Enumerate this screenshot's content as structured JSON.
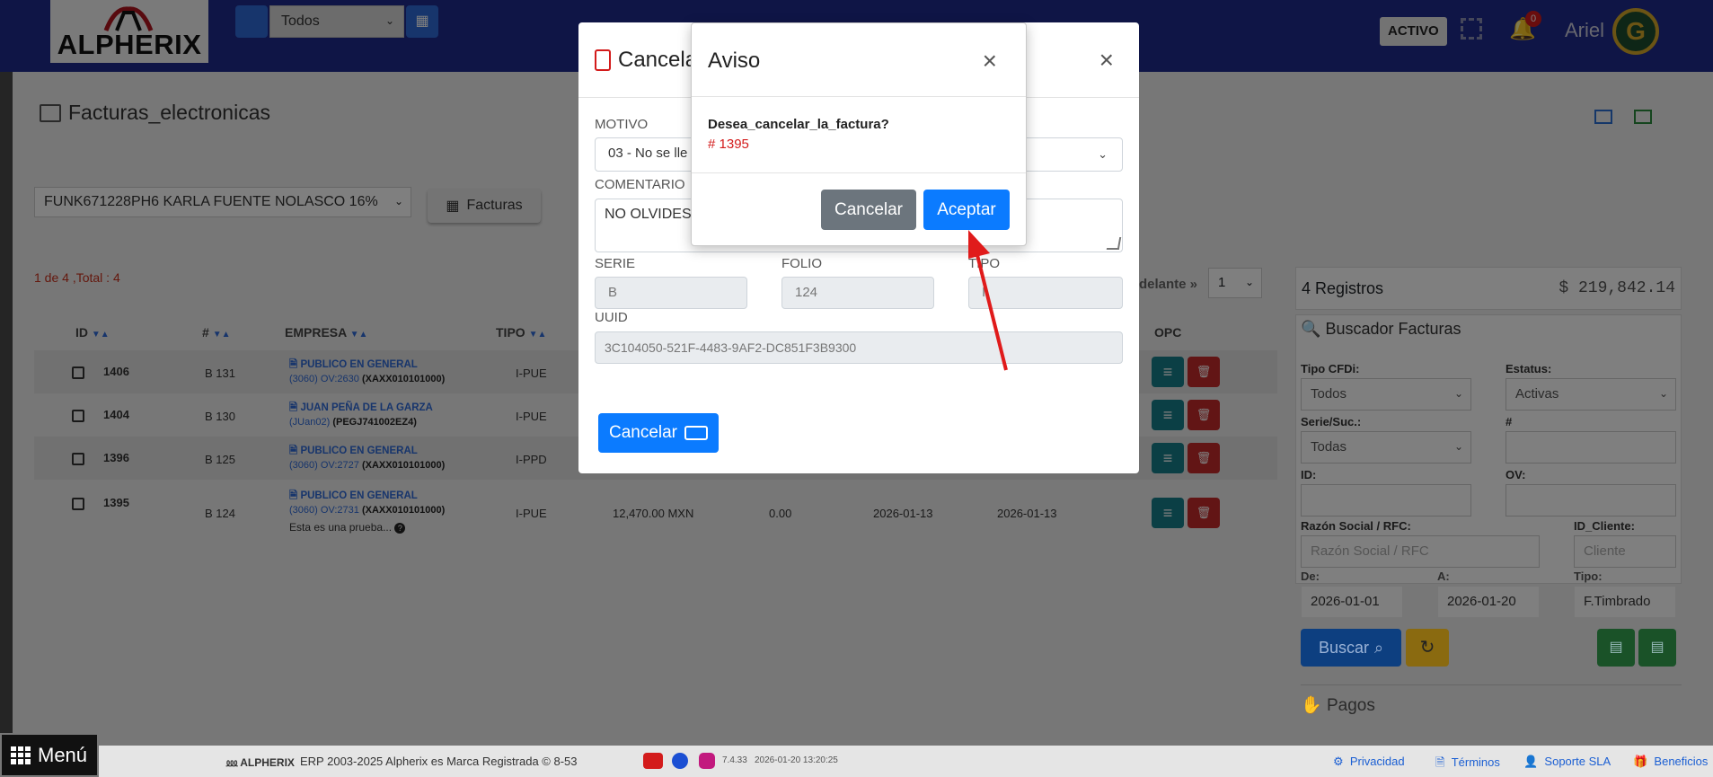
{
  "topbar": {
    "logo_text": "ALPHERIX",
    "branch_select": "Todos",
    "status_badge": "ACTIVO",
    "notifications_count": "0",
    "user_name": "Ariel"
  },
  "page": {
    "title": "Facturas_electronicas",
    "company_select": "FUNK671228PH6 KARLA FUENTE NOLASCO 16%",
    "facturas_button": "Facturas",
    "paging_info": "1 de 4 ,Total : 4",
    "adelante": "delante »",
    "page_number": "1"
  },
  "table": {
    "headers": {
      "id": "ID",
      "num": "#",
      "empresa": "EMPRESA",
      "tipo": "TIPO",
      "opc": "OPC"
    },
    "rows": [
      {
        "id": "1406",
        "num": "B 131",
        "empresa": "PUBLICO EN GENERAL",
        "sub": "(3060) OV:2630",
        "rfc": "(XAXX010101000)",
        "tipo": "I-PUE"
      },
      {
        "id": "1404",
        "num": "B 130",
        "empresa": "JUAN PEÑA DE LA GARZA",
        "sub": "(JUan02)",
        "rfc": "(PEGJ741002EZ4)",
        "tipo": "I-PUE"
      },
      {
        "id": "1396",
        "num": "B 125",
        "empresa": "PUBLICO EN GENERAL",
        "sub": "(3060) OV:2727",
        "rfc": "(XAXX010101000)",
        "tipo": "I-PPD"
      },
      {
        "id": "1395",
        "num": "B 124",
        "empresa": "PUBLICO EN GENERAL",
        "sub": "(3060) OV:2731",
        "rfc": "(XAXX010101000)",
        "tipo": "I-PUE",
        "note": "Esta es una prueba...",
        "total": "12,470.00 MXN",
        "saldo": "0.00",
        "fecha1": "2026-01-13",
        "fecha2": "2026-01-13"
      }
    ]
  },
  "right_panel": {
    "registros": "4 Registros",
    "total": "$ 219,842.14",
    "buscador_title": "Buscador Facturas",
    "tipo_cfdi_label": "Tipo CFDi:",
    "tipo_cfdi_value": "Todos",
    "estatus_label": "Estatus:",
    "estatus_value": "Activas",
    "serie_label": "Serie/Suc.:",
    "serie_value": "Todas",
    "num_label": "#",
    "id_label": "ID:",
    "ov_label": "OV:",
    "razon_label": "Razón Social / RFC:",
    "razon_placeholder": "Razón Social / RFC",
    "id_cliente_label": "ID_Cliente:",
    "id_cliente_placeholder": "Cliente",
    "de_label": "De:",
    "de_value": "2026-01-01",
    "a_label": "A:",
    "a_value": "2026-01-20",
    "tipo_label": "Tipo:",
    "tipo_value": "F.Timbrado",
    "buscar_button": "Buscar",
    "pagos_title": "Pagos"
  },
  "modal_cancel": {
    "title": "Cancela",
    "motivo_label": "MOTIVO",
    "motivo_value": "03 - No se lle",
    "comentario_label": "COMENTARIO",
    "comentario_value": "NO OLVIDES",
    "serie_label": "SERIE",
    "serie_value": "B",
    "folio_label": "FOLIO",
    "folio_value": "124",
    "tipo_label": "TIPO",
    "tipo_value": "I",
    "uuid_label": "UUID",
    "uuid_value": "3C104050-521F-4483-9AF2-DC851F3B9300",
    "cancel_button": "Cancelar"
  },
  "modal_aviso": {
    "title": "Aviso",
    "question": "Desea_cancelar_la_factura?",
    "invoice_number": "# 1395",
    "cancel_button": "Cancelar",
    "accept_button": "Aceptar"
  },
  "footer": {
    "menu": "Menú",
    "brand": "ALPHERIX",
    "copyright": "ERP 2003-2025 Alpherix es Marca Registrada © 8-53",
    "version": "7.4.33",
    "datetime": "2026-01-20 13:20:25",
    "privacidad": "Privacidad",
    "terminos": "Términos",
    "soporte": "Soporte SLA",
    "beneficios": "Beneficios"
  },
  "colors": {
    "primary": "#0b7bff",
    "danger": "#d31b1b",
    "secondary": "#6c757d",
    "topbar": "#1f2a8c"
  }
}
